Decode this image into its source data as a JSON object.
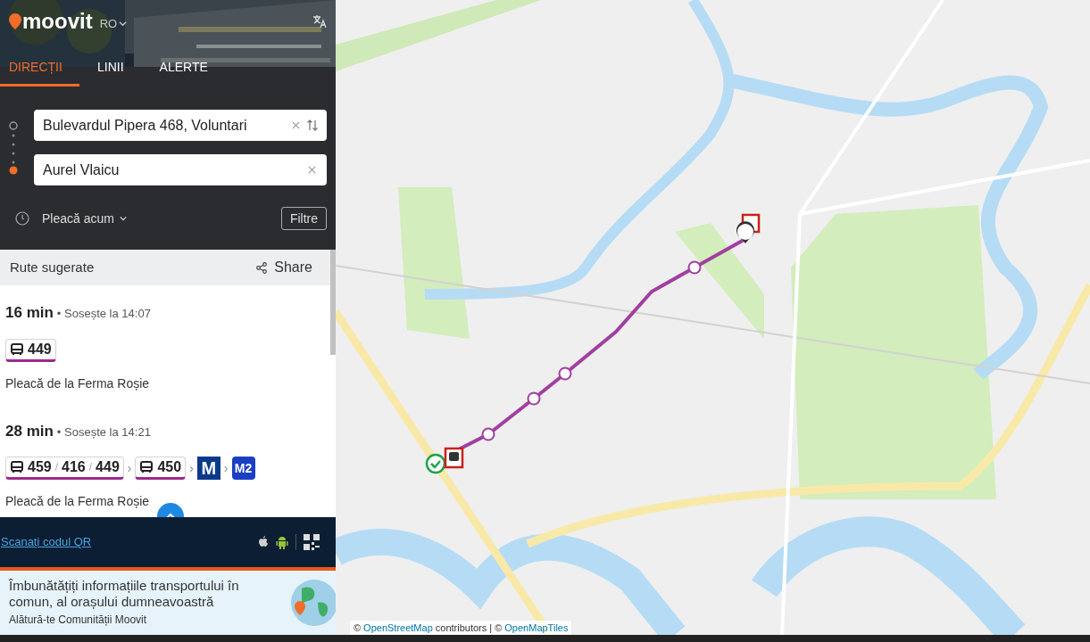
{
  "header": {
    "logo": "moovit",
    "language": "RO"
  },
  "tabs": [
    {
      "label": "DIRECȚII",
      "selected": true
    },
    {
      "label": "LINII",
      "selected": false
    },
    {
      "label": "ALERTE",
      "selected": false
    }
  ],
  "origin": {
    "value": "Bulevardul Pipera 468, Voluntari"
  },
  "destination": {
    "value": "Aurel Vlaicu"
  },
  "depart": "Pleacă acum",
  "filter_button": "Filtre",
  "routes_header": {
    "title": "Rute sugerate",
    "share": "Share"
  },
  "routes": [
    {
      "duration": "16 min",
      "arrival": "• Sosește la 14:07",
      "legs": [
        {
          "kind": "bus",
          "lines": [
            "449"
          ]
        }
      ],
      "departure": "Pleacă de la Ferma Roșie"
    },
    {
      "duration": "28 min",
      "arrival": "• Sosește la 14:21",
      "leg_separator": "›",
      "legs": [
        {
          "kind": "bus",
          "separator": "/",
          "lines": [
            "459",
            "416",
            "449"
          ]
        },
        {
          "kind": "bus",
          "lines": [
            "450"
          ]
        },
        {
          "kind": "metro_logo",
          "label": "M"
        },
        {
          "kind": "metro_line",
          "label": "M2"
        }
      ],
      "departure": "Pleacă de la Ferma Roșie"
    }
  ],
  "qr_link": "Scanați codul QR",
  "promo": {
    "title": "Îmbunătățiți informațiile transportului în comun, al orașului dumneavoastră",
    "subtitle": "Alătură-te Comunității Moovit"
  },
  "attribution": [
    {
      "text": "©",
      "link": false
    },
    {
      "text": "OpenStreetMap",
      "link": true
    },
    {
      "text": "contributors | ©",
      "link": false
    },
    {
      "text": "OpenMapTiles",
      "link": true
    }
  ]
}
